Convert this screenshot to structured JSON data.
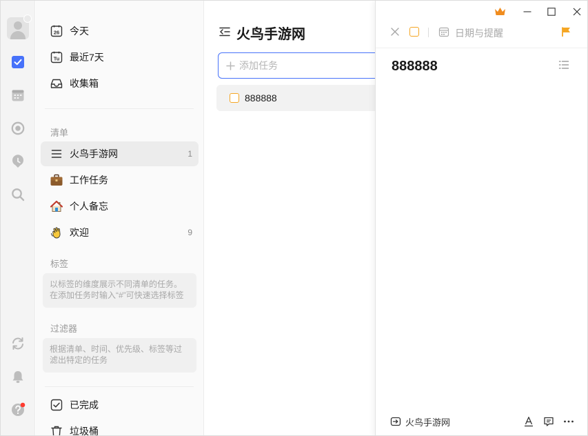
{
  "rail": {
    "icons": [
      "avatar",
      "crown-badge-icon",
      "checkbox-icon",
      "calendar-icon",
      "focus-icon",
      "habit-icon",
      "search-icon",
      "sync-icon",
      "bell-icon",
      "help-icon"
    ]
  },
  "sidebar": {
    "smart": [
      {
        "label": "今天",
        "icon": "calendar-26-icon",
        "date": "26"
      },
      {
        "label": "最近7天",
        "icon": "calendar-tu-icon",
        "date": "Tu"
      },
      {
        "label": "收集箱",
        "icon": "inbox-icon"
      }
    ],
    "lists_title": "清单",
    "lists": [
      {
        "label": "火鸟手游网",
        "icon": "list-icon",
        "count": "1",
        "active": true
      },
      {
        "label": "工作任务",
        "icon": "briefcase-icon",
        "count": ""
      },
      {
        "label": "个人备忘",
        "icon": "house-icon",
        "count": ""
      },
      {
        "label": "欢迎",
        "icon": "waving-hand-icon",
        "count": "9"
      }
    ],
    "tags_title": "标签",
    "tags_hint_1": "以标签的维度展示不同清单的任务。",
    "tags_hint_2": "在添加任务时输入“#”可快速选择标签",
    "filters_title": "过滤器",
    "filters_hint_1": "根据清单、时间、优先级、标签等过",
    "filters_hint_2": "滤出特定的任务",
    "completed": "已完成",
    "trash": "垃圾桶"
  },
  "list": {
    "title": "火鸟手游网",
    "add_placeholder": "添加任务",
    "tasks": [
      {
        "title": "888888"
      }
    ]
  },
  "detail": {
    "date_placeholder": "日期与提醒",
    "title": "888888",
    "footer_list": "火鸟手游网",
    "flag_color": "#f5a623",
    "checkbox_color": "#f5a623",
    "accent": "#4772fa"
  }
}
